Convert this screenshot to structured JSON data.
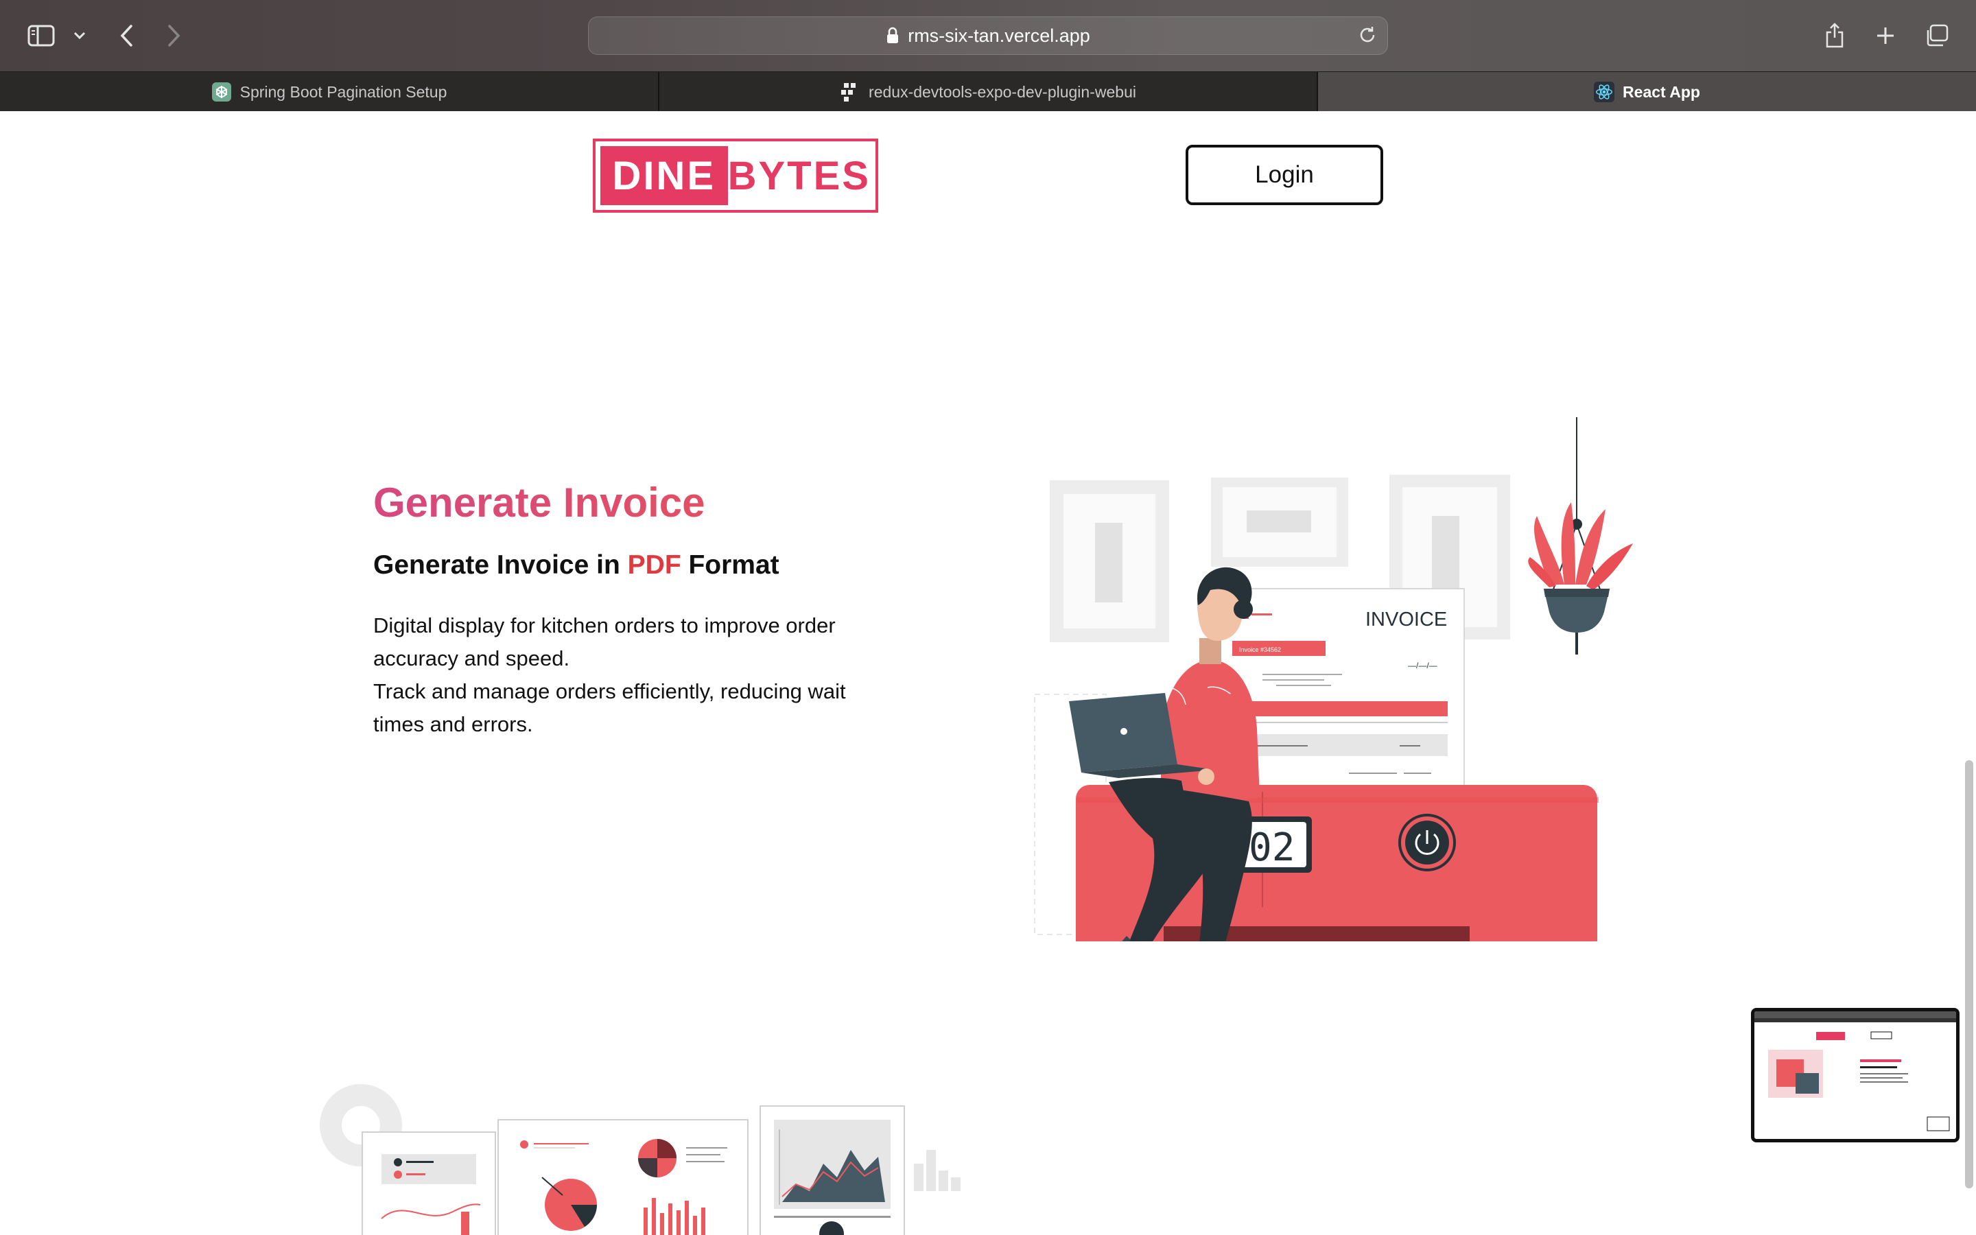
{
  "browser": {
    "url": "rms-six-tan.vercel.app",
    "tabs": [
      {
        "label": "Spring Boot Pagination Setup",
        "active": false,
        "favicon": "openai-icon"
      },
      {
        "label": "redux-devtools-expo-dev-plugin-webui",
        "active": false,
        "favicon": "expo-icon"
      },
      {
        "label": "React App",
        "active": true,
        "favicon": "react-icon"
      }
    ]
  },
  "header": {
    "logo_left": "DINE",
    "logo_right": "BYTES",
    "login_label": "Login"
  },
  "hero": {
    "title": "Generate Invoice",
    "subtitle_before": "Generate Invoice in ",
    "subtitle_highlight": "PDF",
    "subtitle_after": " Format",
    "description_lines": [
      "Digital display for kitchen orders to improve order accuracy and speed.",
      "Track and manage orders efficiently, reducing wait times and errors."
    ]
  },
  "illustration": {
    "invoice_heading": "INVOICE",
    "invoice_number": "Invoice #34562",
    "invoice_date": "—/—/—",
    "printer_counter": "02"
  },
  "colors": {
    "brand": "#e53a62",
    "accent_red": "#eb5a5f",
    "dark_red": "#7e2a2f",
    "ink": "#263238"
  }
}
